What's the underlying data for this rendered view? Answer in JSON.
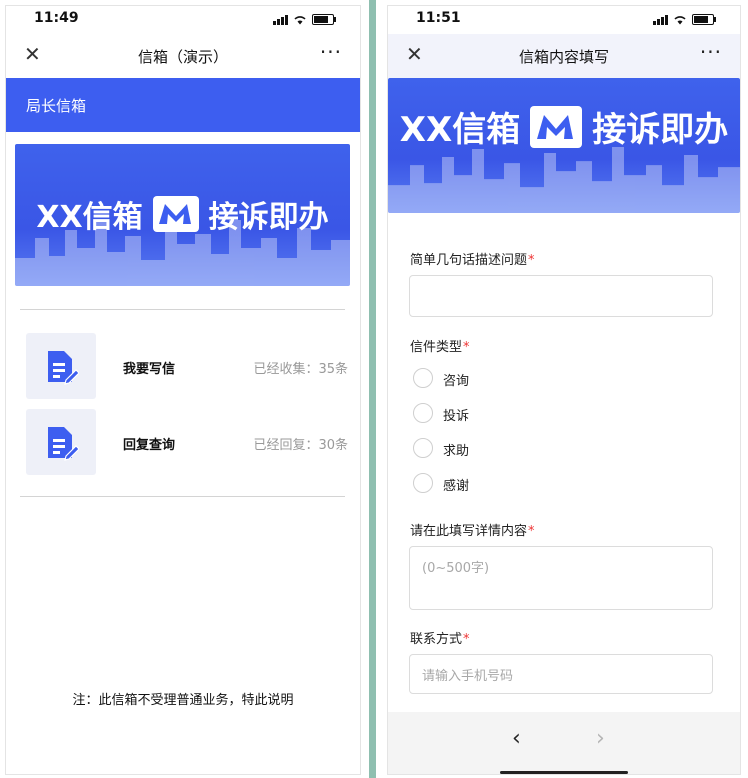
{
  "left": {
    "status_time": "11:49",
    "nav_title": "信箱（演示）",
    "strip_title": "局长信箱",
    "banner": {
      "left": "XX信箱",
      "right": "接诉即办"
    },
    "items": [
      {
        "label": "我要写信",
        "stat": "已经收集：35条",
        "icon": "document-edit-icon"
      },
      {
        "label": "回复查询",
        "stat": "已经回复：30条",
        "icon": "document-edit-icon"
      }
    ],
    "footnote": "注：此信箱不受理普通业务，特此说明"
  },
  "right": {
    "status_time": "11:51",
    "nav_title": "信箱内容填写",
    "banner": {
      "left": "XX信箱",
      "right": "接诉即办"
    },
    "fields": {
      "summary_label": "简单几句话描述问题",
      "type_label": "信件类型",
      "type_options": [
        "咨询",
        "投诉",
        "求助",
        "感谢"
      ],
      "detail_label": "请在此填写详情内容",
      "detail_placeholder": "(0~500字)",
      "contact_label": "联系方式",
      "contact_placeholder": "请输入手机号码"
    },
    "required_mark": "*",
    "toolbar": {
      "back": "‹",
      "forward": "›"
    }
  },
  "common": {
    "close_glyph": "✕",
    "more_glyph": "···",
    "accent": "#3d5ef0",
    "required_color": "#e33333"
  }
}
